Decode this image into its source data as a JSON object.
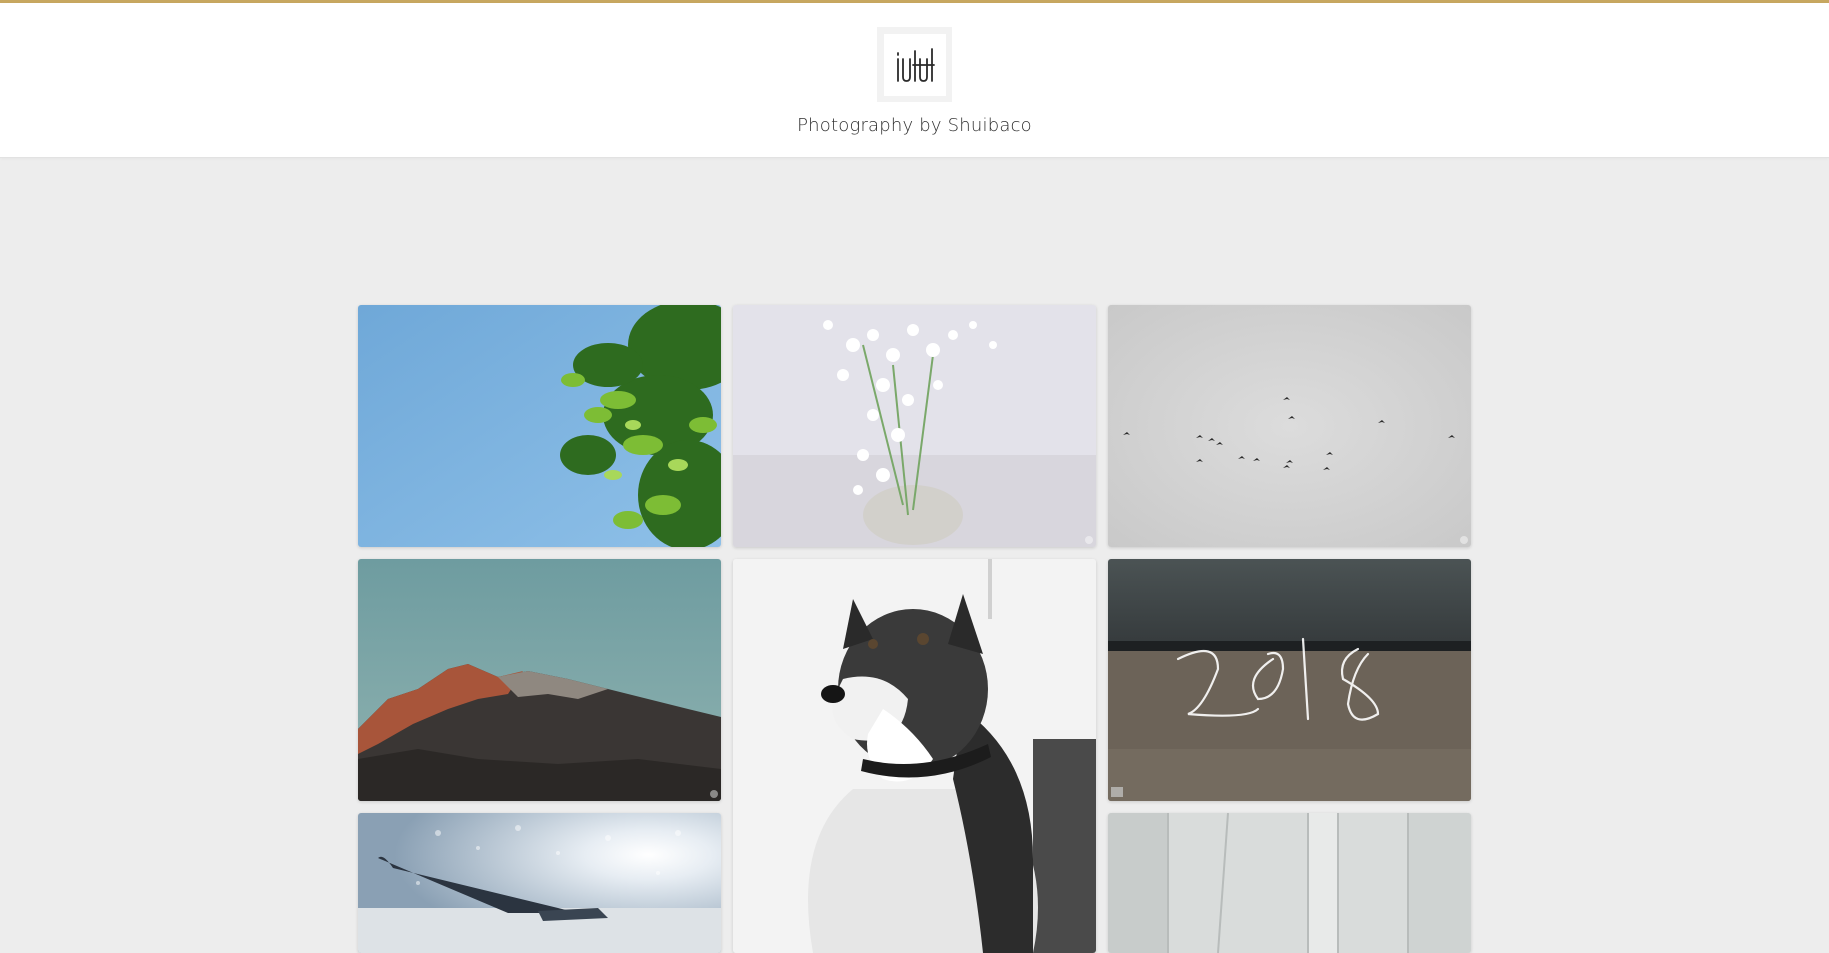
{
  "header": {
    "site_title": "Photography by Shuibaco",
    "accent_color": "#c7a760",
    "logo_icon": "shuibaco-logo"
  },
  "gallery": {
    "photos": [
      {
        "name": "photo-green-leaves-sky",
        "subject": "leaves"
      },
      {
        "name": "photo-white-flowers",
        "subject": "flowers"
      },
      {
        "name": "photo-birds-grey-sky",
        "subject": "birds"
      },
      {
        "name": "photo-mountain-sunset",
        "subject": "mountain"
      },
      {
        "name": "photo-husky-dog-snow",
        "subject": "dog"
      },
      {
        "name": "photo-2018-light-painting",
        "subject": "light-painting"
      },
      {
        "name": "photo-airplane-wing",
        "subject": "airplane"
      },
      {
        "name": "photo-glass-corridor",
        "subject": "corridor"
      }
    ]
  }
}
